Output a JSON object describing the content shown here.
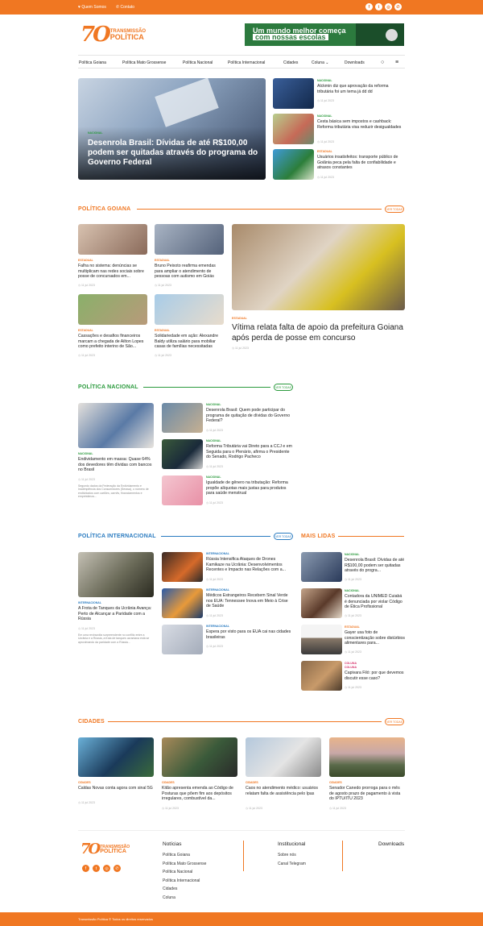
{
  "topbar": {
    "links": [
      {
        "icon": "heart-icon",
        "label": "Quem Somos"
      },
      {
        "icon": "phone-icon",
        "label": "Contato"
      }
    ],
    "social": [
      "facebook-icon",
      "twitter-icon",
      "instagram-icon",
      "whatsapp-icon"
    ]
  },
  "logo": {
    "number": "7O",
    "line1": "TRANSMISSÃO",
    "line2": "POLÍTICA"
  },
  "banner": {
    "line1": "Um mundo melhor começa",
    "line2": "com nossas escolas"
  },
  "nav": {
    "items": [
      "Política Goiana",
      "Política Mato Grossense",
      "Política Nacional",
      "Política Internacional",
      "Cidades",
      "Coluna",
      "Downloads"
    ]
  },
  "hero": {
    "main": {
      "category": "NACIONAL",
      "title": "Desenrola Brasil: Dívidas de até R$100,00 podem ser quitadas através do programa do Governo Federal"
    },
    "side": [
      {
        "category": "NACIONAL",
        "title": "Alckmin diz que aprovação da reforma tributária foi um tema já dd dd",
        "date": "11 jul 2023"
      },
      {
        "category": "NACIONAL",
        "title": "Cesta básica sem impostos e cashback: Reforma tributária visa reduzir desigualdades",
        "date": "11 jul 2023"
      },
      {
        "category": "ESTADUAL",
        "title": "Usuários insatisfeitos: transporte público de Goiânia peca pela falta de confiabilidade e atrasos constantes",
        "date": "11 jul 2023"
      }
    ]
  },
  "goiana": {
    "title": "POLÍTICA GOIANA",
    "more": "VER TODAS",
    "cards": [
      {
        "category": "ESTADUAL",
        "title": "Falha no sistema: denúncias se multiplicam nas redes sociais sobre posse de concursados em...",
        "date": "11 jul 2023"
      },
      {
        "category": "ESTADUAL",
        "title": "Bruno Peixoto reafirma emendas para ampliar o atendimento de pessoas com autismo em Goiás",
        "date": "11 jul 2023"
      },
      {
        "category": "ESTADUAL",
        "title": "Cassações e desafios financeiros marcam a chegada de Ailton Lopes como prefeito interino de São...",
        "date": "11 jul 2023"
      },
      {
        "category": "ESTADUAL",
        "title": "Solidariedade em ação: Alexandre Baldy utiliza salário para mobiliar casas de famílias necessitadas",
        "date": "11 jul 2023"
      }
    ],
    "feature": {
      "category": "ESTADUAL",
      "title": "Vítima relata falta de apoio da prefeitura Goiana após perda de posse em concurso",
      "date": "11 jul 2023"
    }
  },
  "nacional": {
    "title": "POLÍTICA NACIONAL",
    "more": "VER TODAS",
    "main": {
      "category": "NACIONAL",
      "title": "Endividamento em massa: Quase 64% dos devedores têm dívidas com bancos no Brasil",
      "date": "11 jul 2023",
      "excerpt": "Segundo dados da Federação da Endividamento e Inadimplência dos Consumidores (Serasa), o número de endividados com cartões, carnês, financiamentos e empréstimos..."
    },
    "list": [
      {
        "category": "NACIONAL",
        "title": "Desenrola Brasil: Quem pode participar do programa de quitação de dívidas do Governo Federal?",
        "date": "11 jul 2023"
      },
      {
        "category": "NACIONAL",
        "title": "Reforma Tributária vai Direto para a CCJ e em Seguida para o Plenário, afirma o Presidente do Senado, Rodrigo Pacheco",
        "date": "11 jul 2023"
      },
      {
        "category": "NACIONAL",
        "title": "Igualdade de gênero na tributação: Reforma propõe alíquotas mais justas para produtos para saúde menstrual",
        "date": "11 jul 2023"
      }
    ]
  },
  "internacional": {
    "title": "POLÍTICA INTERNACIONAL",
    "more": "VER TODAS",
    "main": {
      "category": "INTERNACIONAL",
      "title": "A Frota de Tanques da Ucrânia Avança: Perto de Alcançar a Paridade com a Rússia",
      "date": "11 jul 2023",
      "excerpt": "Em uma reviravolta surpreendente no conflito entre a Ucrânia e a Rússia, a frota de tanques ucraniana está se aproximando da paridade com a Rússia..."
    },
    "list": [
      {
        "category": "INTERNACIONAL",
        "title": "Rússia Intensifica Ataques de Drones Kamikaze na Ucrânia: Desenvolvimentos Recentes e Impacto nas Relações com a...",
        "date": "11 jul 2023"
      },
      {
        "category": "INTERNACIONAL",
        "title": "Médicos Estrangeiros Recebem Sinal Verde nos EUA: Tennessee Inova em Meio à Crise de Saúde",
        "date": "11 jul 2023"
      },
      {
        "category": "INTERNACIONAL",
        "title": "Espera por visto para os EUA cai nas cidades brasileiras",
        "date": "11 jul 2023"
      }
    ]
  },
  "mais_lidas": {
    "title": "MAIS LIDAS",
    "items": [
      {
        "category": "NACIONAL",
        "title": "Desenrola Brasil: Dívidas de até R$100,00 podem ser quitadas através do progra...",
        "date": "11 jul 2023"
      },
      {
        "category": "NACIONAL",
        "title": "Contadora da UNIMED Cuiabá é denunciada por violar Código de Ética Profissional",
        "date": "11 jul 2023"
      },
      {
        "category": "ESTADUAL",
        "title": "Gayer usa foto de conscientização sobre distúrbios alimentares para...",
        "date": "11 jul 2023"
      },
      {
        "category": "COLUNA",
        "category2": "COLUNA",
        "title": "Capivara Filó: por que devemos discutir esse caso?",
        "date": "11 jul 2023"
      }
    ]
  },
  "cidades": {
    "title": "CIDADES",
    "more": "VER TODAS",
    "cards": [
      {
        "category": "CIDADES",
        "title": "Caldas Novas conta agora com sinal 5G",
        "date": "11 jul 2023"
      },
      {
        "category": "CIDADES",
        "title": "Kitão apresenta emenda ao Código de Posturas que põem fim aos depósitos irregulares, combustível da...",
        "date": "11 jul 2023"
      },
      {
        "category": "CIDADES",
        "title": "Caos no atendimento médico: usuários relatam falta de assistência pelo Ipas",
        "date": "11 jul 2023"
      },
      {
        "category": "CIDADES",
        "title": "Senador Canedo prorroga para o mês de agosto prazo de pagamento à vista do IPTU/ITU 2023",
        "date": "11 jul 2023"
      }
    ]
  },
  "footer": {
    "noticias": {
      "title": "Notícias",
      "links": [
        "Política Goiana",
        "Política Mato Grossense",
        "Política Nacional",
        "Política Internacional",
        "Cidades",
        "Coluna"
      ]
    },
    "institucional": {
      "title": "Institucional",
      "links": [
        "Sobre nós",
        "Canal Telegram"
      ]
    },
    "downloads": {
      "title": "Downloads"
    },
    "copyright": "Transmissão Política © Todos os direitos reservados"
  },
  "colors": {
    "accent": "#f07722",
    "green": "#2a9a3c",
    "blue": "#2a7bc0"
  }
}
